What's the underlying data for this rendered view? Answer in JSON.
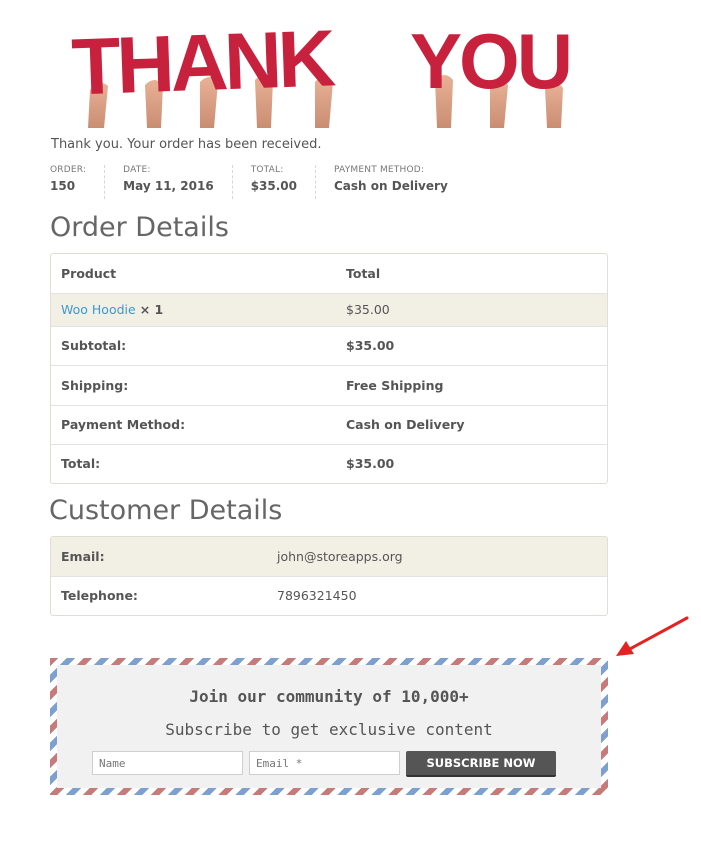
{
  "banner": {
    "text_left": "THANK",
    "text_right": "YOU"
  },
  "thanks_message": "Thank you. Your order has been received.",
  "overview": [
    {
      "label": "ORDER:",
      "value": "150"
    },
    {
      "label": "DATE:",
      "value": "May 11, 2016"
    },
    {
      "label": "TOTAL:",
      "value": "$35.00"
    },
    {
      "label": "PAYMENT METHOD:",
      "value": "Cash on Delivery"
    }
  ],
  "order_details": {
    "heading": "Order Details",
    "col_product": "Product",
    "col_total": "Total",
    "item": {
      "name": "Woo Hoodie",
      "qty": "× 1",
      "total": "$35.00"
    },
    "rows": [
      {
        "label": "Subtotal:",
        "value": "$35.00"
      },
      {
        "label": "Shipping:",
        "value": "Free Shipping"
      },
      {
        "label": "Payment Method:",
        "value": "Cash on Delivery"
      },
      {
        "label": "Total:",
        "value": "$35.00"
      }
    ]
  },
  "customer_details": {
    "heading": "Customer Details",
    "rows": [
      {
        "label": "Email:",
        "value": "john@storeapps.org"
      },
      {
        "label": "Telephone:",
        "value": "7896321450"
      }
    ]
  },
  "subscribe": {
    "title": "Join our community of 10,000+",
    "subtitle": "Subscribe to get exclusive content",
    "name_placeholder": "Name",
    "email_placeholder": "Email *",
    "button_label": "SUBSCRIBE NOW"
  },
  "colors": {
    "banner_red": "#c8213d",
    "link": "#3a9bd0",
    "arrow": "#e52222",
    "stripe_red": "#c77a7a",
    "stripe_blue": "#7ea0cf"
  },
  "icons": {
    "annotation": "red-arrow-icon"
  }
}
